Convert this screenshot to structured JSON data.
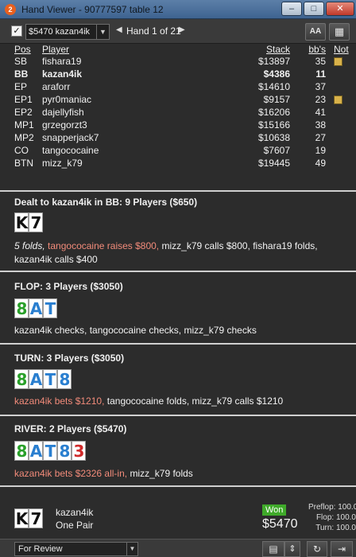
{
  "window": {
    "icon_text": "2",
    "title": "Hand Viewer - 90777597 table 12",
    "controls": {
      "minimize": "–",
      "maximize": "□",
      "close": "✕"
    }
  },
  "toolbar": {
    "checkbox_mark": "✓",
    "hand_select_value": "$5470 kazan4ik",
    "hand_nav_label": "Hand 1 of 21",
    "prev_icon": "◀",
    "next_icon": "▶",
    "font_button": "AA",
    "grid_button": "▦"
  },
  "players": {
    "headers": {
      "pos": "Pos",
      "player": "Player",
      "stack": "Stack",
      "bbs": "bb's",
      "notes": "Not"
    },
    "rows": [
      {
        "pos": "SB",
        "name": "fishara19",
        "stack": "$13897",
        "bbs": "35",
        "note": true
      },
      {
        "pos": "BB",
        "name": "kazan4ik",
        "stack": "$4386",
        "bbs": "11",
        "note": false
      },
      {
        "pos": "EP",
        "name": "araforr",
        "stack": "$14610",
        "bbs": "37",
        "note": false
      },
      {
        "pos": "EP1",
        "name": "pyr0maniac",
        "stack": "$9157",
        "bbs": "23",
        "note": true
      },
      {
        "pos": "EP2",
        "name": "dajellyfish",
        "stack": "$16206",
        "bbs": "41",
        "note": false
      },
      {
        "pos": "MP1",
        "name": "grzegorzt3",
        "stack": "$15166",
        "bbs": "38",
        "note": false
      },
      {
        "pos": "MP2",
        "name": "snapperjack7",
        "stack": "$10638",
        "bbs": "27",
        "note": false
      },
      {
        "pos": "CO",
        "name": "tangococaine",
        "stack": "$7607",
        "bbs": "19",
        "note": false
      },
      {
        "pos": "BTN",
        "name": "mizz_k79",
        "stack": "$19445",
        "bbs": "49",
        "note": false
      }
    ]
  },
  "preflop": {
    "title": "Dealt to kazan4ik in BB: 9 Players ($650)",
    "cards": [
      {
        "rank": "K",
        "color": "#111111"
      },
      {
        "rank": "7",
        "color": "#111111"
      }
    ],
    "folds": "5 folds,",
    "raise": "tangococaine raises $800,",
    "rest": "mizz_k79 calls $800, fishara19 folds, kazan4ik calls $400"
  },
  "flop": {
    "title": "FLOP: 3 Players ($3050)",
    "cards": [
      {
        "rank": "8",
        "color": "#2aa02a"
      },
      {
        "rank": "A",
        "color": "#2a7fd0"
      },
      {
        "rank": "T",
        "color": "#2a7fd0"
      }
    ],
    "action": "kazan4ik checks, tangococaine checks, mizz_k79 checks"
  },
  "turn": {
    "title": "TURN: 3 Players ($3050)",
    "cards": [
      {
        "rank": "8",
        "color": "#2aa02a"
      },
      {
        "rank": "A",
        "color": "#2a7fd0"
      },
      {
        "rank": "T",
        "color": "#2a7fd0"
      },
      {
        "rank": "8",
        "color": "#2a7fd0"
      }
    ],
    "bet": "kazan4ik bets $1210,",
    "rest": "tangococaine folds, mizz_k79 calls $1210"
  },
  "river": {
    "title": "RIVER: 2 Players ($5470)",
    "cards": [
      {
        "rank": "8",
        "color": "#2aa02a"
      },
      {
        "rank": "A",
        "color": "#2a7fd0"
      },
      {
        "rank": "T",
        "color": "#2a7fd0"
      },
      {
        "rank": "8",
        "color": "#2a7fd0"
      },
      {
        "rank": "3",
        "color": "#d02a2a"
      }
    ],
    "bet": "kazan4ik bets $2326 all-in,",
    "rest": "mizz_k79 folds"
  },
  "summary": {
    "cards": [
      {
        "rank": "K",
        "color": "#111111"
      },
      {
        "rank": "7",
        "color": "#111111"
      }
    ],
    "player": "kazan4ik",
    "hand": "One Pair",
    "won_label": "Won",
    "won_amount": "$5470",
    "equity": [
      "Preflop: 100.0",
      "Flop: 100.0",
      "Turn: 100.0"
    ]
  },
  "statusbar": {
    "review_value": "For Review",
    "calc_icon": "▤",
    "spin_icon": "⇕",
    "refresh_icon": "↻",
    "exit_icon": "⇥"
  }
}
